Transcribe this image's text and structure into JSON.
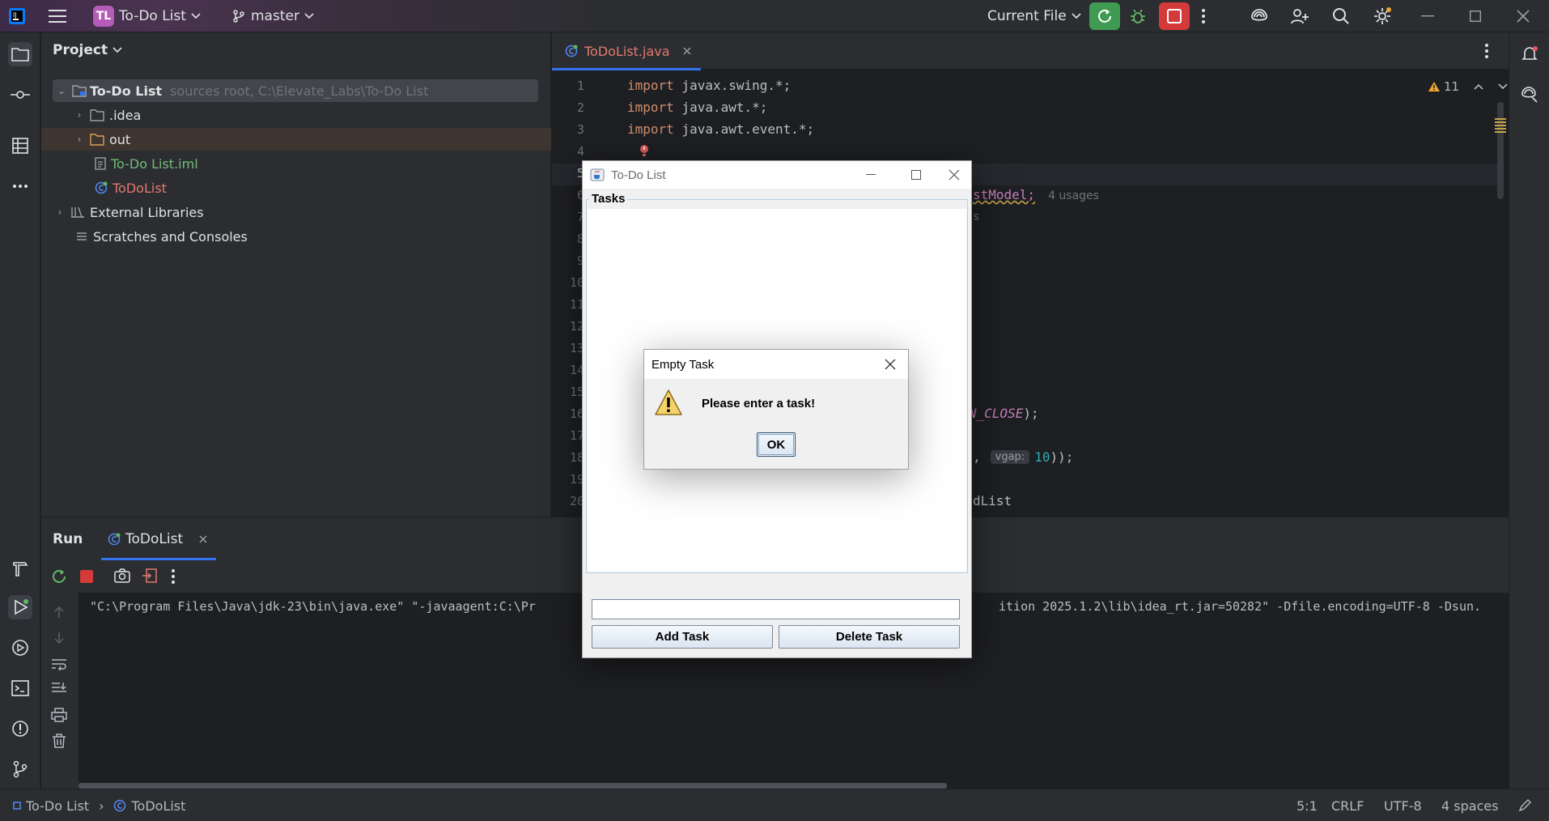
{
  "titlebar": {
    "project_badge": "TL",
    "project_name": "To-Do List",
    "branch": "master",
    "run_config": "Current File"
  },
  "project_panel": {
    "title": "Project",
    "tree": [
      {
        "label": "To-Do List",
        "hint": "sources root,  C:\\Elevate_Labs\\To-Do List"
      },
      {
        "label": ".idea"
      },
      {
        "label": "out"
      },
      {
        "label": "To-Do List.iml"
      },
      {
        "label": "ToDoList"
      },
      {
        "label": "External Libraries"
      },
      {
        "label": "Scratches and Consoles"
      }
    ]
  },
  "editor": {
    "tab": "ToDoList.java",
    "warnings": "11",
    "lines": [
      {
        "n": "1",
        "kw": "import",
        "rest": " javax.swing.*;"
      },
      {
        "n": "2",
        "kw": "import",
        "rest": " java.awt.*;"
      },
      {
        "n": "3",
        "kw": "import",
        "rest": " java.awt.event.*;"
      },
      {
        "n": "4"
      },
      {
        "n": "5"
      },
      {
        "n": "6",
        "tail": "stModel;",
        "hint": "4 usages"
      },
      {
        "n": "7",
        "tail": "s"
      },
      {
        "n": "8"
      },
      {
        "n": "9"
      },
      {
        "n": "10"
      },
      {
        "n": "11"
      },
      {
        "n": "12"
      },
      {
        "n": "13"
      },
      {
        "n": "14"
      },
      {
        "n": "15"
      },
      {
        "n": "16",
        "tail": "T_ON_CLOSE",
        "tail2": ");"
      },
      {
        "n": "17"
      },
      {
        "n": "18",
        "tail": ",",
        "param": "vgap:",
        "num": "10",
        "tail2": "));"
      },
      {
        "n": "19"
      },
      {
        "n": "20",
        "tail": "dList"
      }
    ]
  },
  "run_panel": {
    "title": "Run",
    "tab": "ToDoList",
    "console_left": "\"C:\\Program Files\\Java\\jdk-23\\bin\\java.exe\" \"-javaagent:C:\\Pr",
    "console_right": "ition 2025.1.2\\lib\\idea_rt.jar=50282\" -Dfile.encoding=UTF-8 -Dsun."
  },
  "statusbar": {
    "crumb_project": "To-Do List",
    "crumb_file": "ToDoList",
    "position": "5:1",
    "line_sep": "CRLF",
    "encoding": "UTF-8",
    "indent": "4 spaces"
  },
  "todo_window": {
    "title": "To-Do List",
    "group": "Tasks",
    "task_input_value": "",
    "add_button": "Add Task",
    "delete_button": "Delete Task"
  },
  "dialog": {
    "title": "Empty Task",
    "message": "Please enter a task!",
    "ok_button": "OK"
  }
}
